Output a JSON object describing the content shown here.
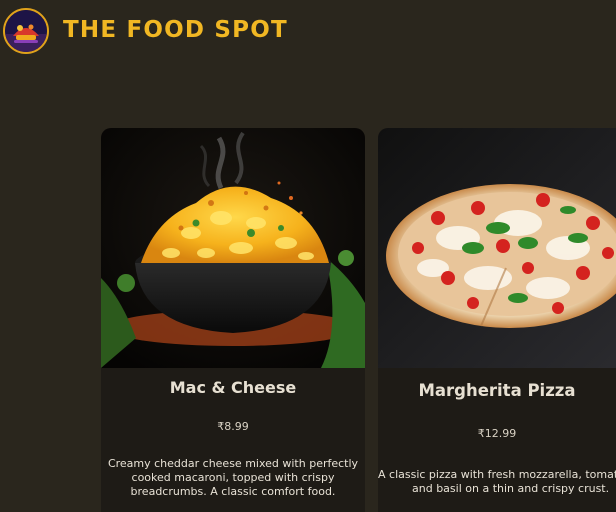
{
  "header": {
    "brand": "THE FOOD SPOT",
    "logo_icon": "food-spot-logo-icon"
  },
  "menu": {
    "items": [
      {
        "title": "Mac & Cheese",
        "price": "₹8.99",
        "description_lines": [
          "Creamy cheddar cheese mixed with perfectly",
          "cooked macaroni, topped with crispy",
          "breadcrumbs. A classic comfort food."
        ],
        "image_icon": "mac-and-cheese-photo"
      },
      {
        "title": "Margherita Pizza",
        "price": "₹12.99",
        "description_lines": [
          "A classic pizza with fresh mozzarella, tomat",
          "and basil on a thin and crispy crust."
        ],
        "image_icon": "margherita-pizza-photo"
      }
    ]
  },
  "colors": {
    "background": "#2a261d",
    "brand": "#f1b723",
    "card": "#1e1b16"
  }
}
